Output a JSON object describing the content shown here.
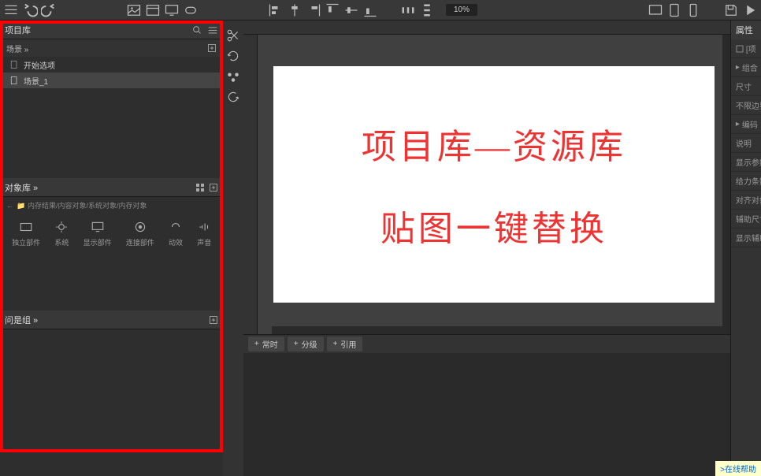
{
  "toolbar": {
    "zoom": "10%"
  },
  "left_panel": {
    "project_lib_title": "项目库",
    "scene_title": "场景",
    "scene_items": [
      {
        "label": "开始选项"
      },
      {
        "label": "场景_1"
      }
    ],
    "object_lib_title": "对象库",
    "breadcrumb": "内存结果/内容对象/系统对象/内存对象",
    "lib_items": [
      {
        "label": "独立部件"
      },
      {
        "label": "系统"
      },
      {
        "label": "显示部件"
      },
      {
        "label": "连接部件"
      },
      {
        "label": "动效"
      },
      {
        "label": "声音"
      }
    ],
    "control_title": "问是组"
  },
  "canvas": {
    "line1": "项目库—资源库",
    "line2": "贴图一键替换"
  },
  "bottom_tabs": [
    {
      "label": "常时"
    },
    {
      "label": "分级"
    },
    {
      "label": "引用"
    }
  ],
  "right_panel": {
    "title": "属性",
    "rows": [
      "[项",
      "组合",
      "尺寸",
      "不限边界",
      "编码",
      "说明",
      "显示参数",
      "给力条数",
      "对齐对象",
      "辅助尺寸",
      "显示辅助"
    ]
  },
  "status_link": ">在线帮助"
}
